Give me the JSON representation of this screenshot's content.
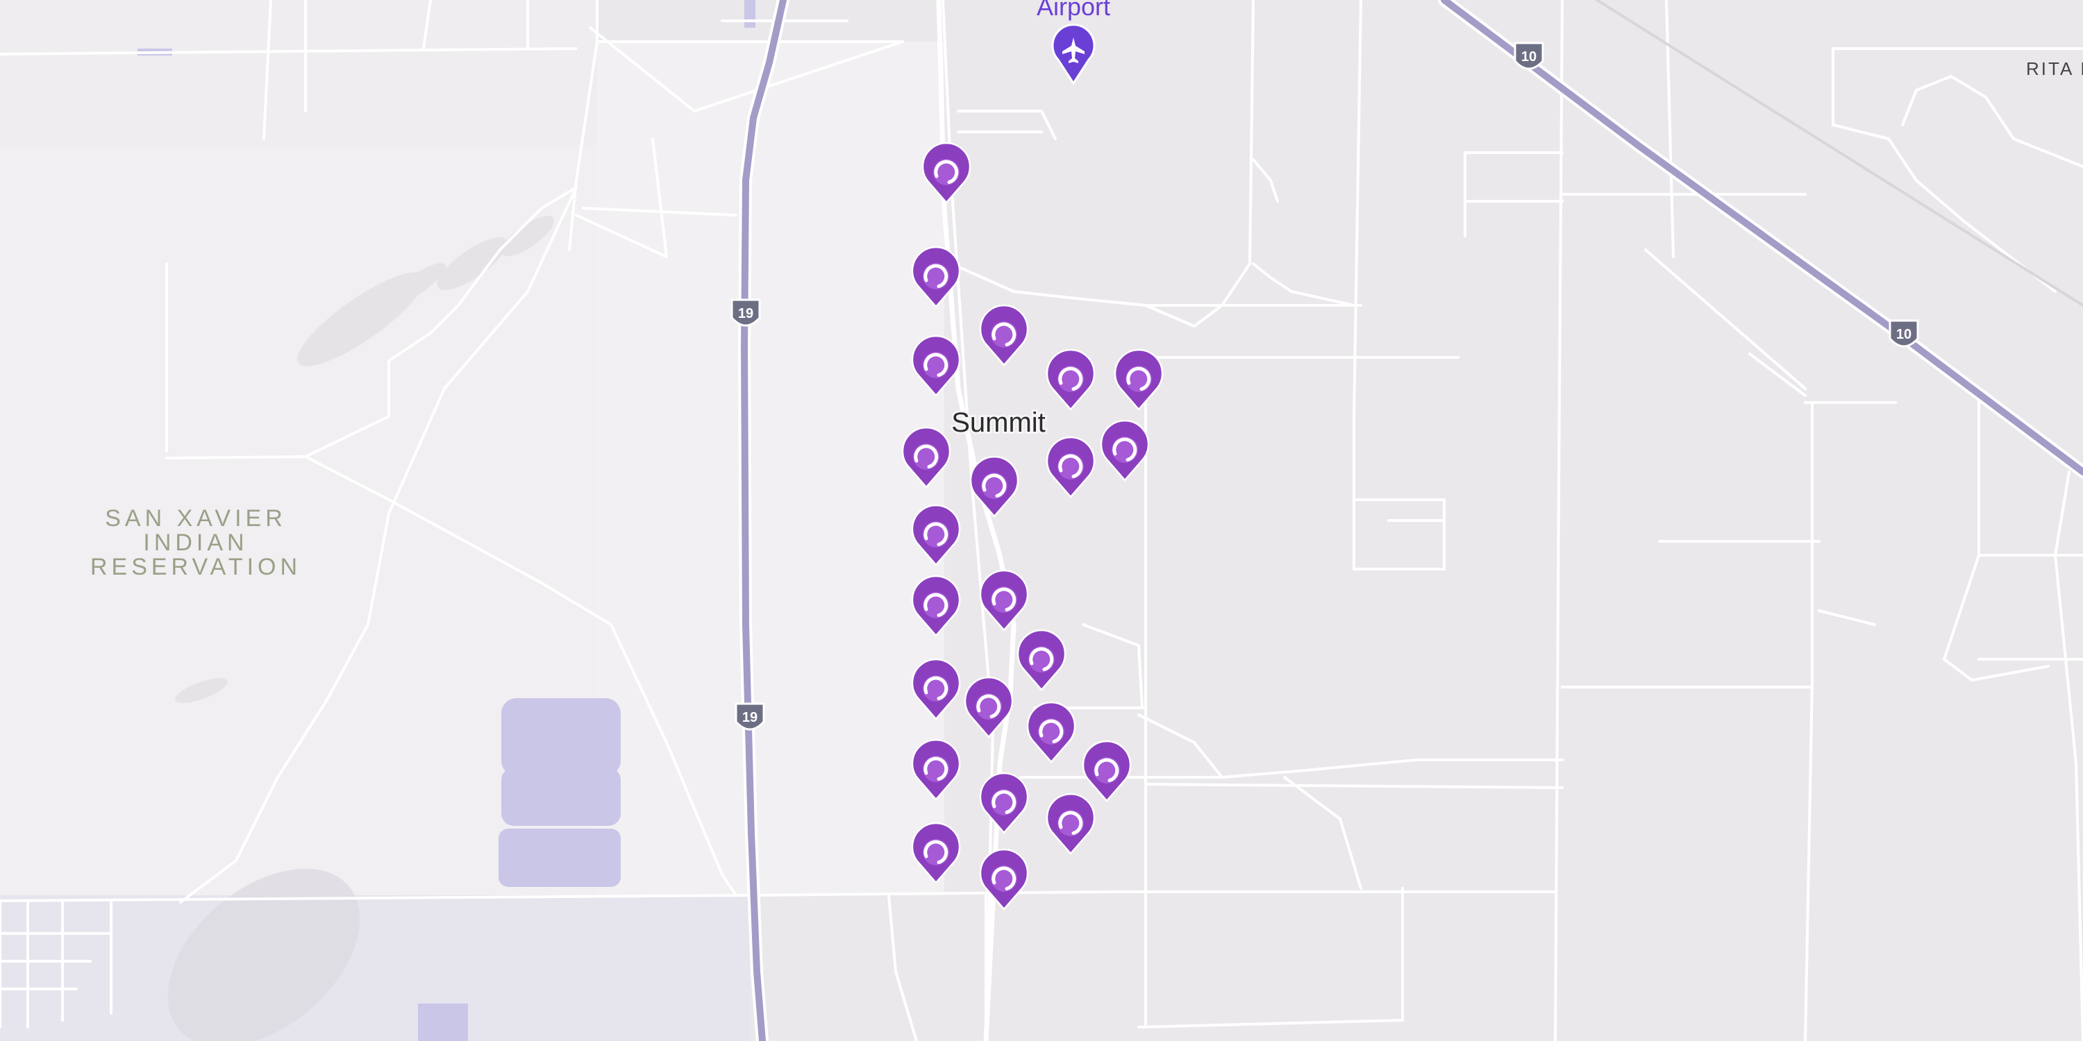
{
  "map": {
    "colors": {
      "background": "#ebe8ec",
      "reservation_area": "#f1eff1",
      "road": "#ffffff",
      "highway": "#a39cc7",
      "water": "#c9c6e8",
      "marker": "#8b3fbf",
      "marker_inner": "#a65ad6",
      "airport_marker": "#6a3fd6"
    },
    "labels": {
      "reservation": [
        "SAN XAVIER",
        "INDIAN",
        "RESERVATION"
      ],
      "place": "Summit",
      "airport": "Airport",
      "road_edge": "RITA I"
    },
    "highway_shields": [
      {
        "route": "19"
      },
      {
        "route": "19"
      },
      {
        "route": "10"
      },
      {
        "route": "10"
      }
    ],
    "location_markers": {
      "count": 24,
      "icon": "loading-ring-pin-icon"
    },
    "airport_icon": "airplane-pin-icon"
  }
}
